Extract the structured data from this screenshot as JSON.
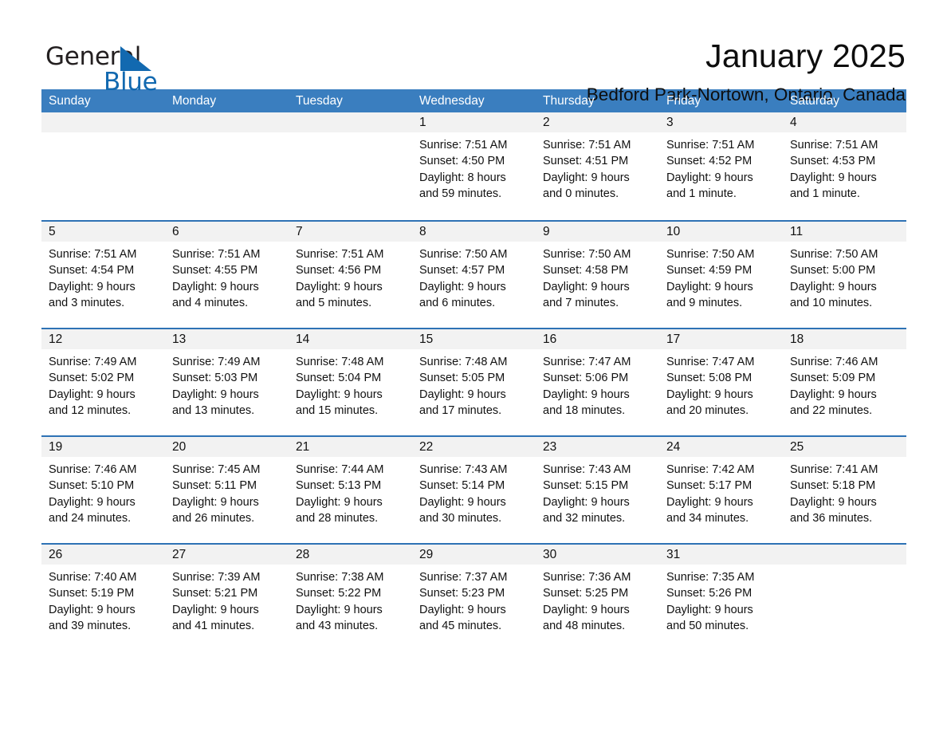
{
  "brand": {
    "word_general": "General",
    "word_blue": "Blue",
    "logo_icon": "triangle-logo-icon",
    "accent_color": "#1269b0"
  },
  "header": {
    "month_title": "January 2025",
    "location": "Bedford Park-Nortown, Ontario, Canada"
  },
  "calendar": {
    "header_bg": "#3a7ebf",
    "row_divider": "#2e72b5",
    "daynum_bg": "#f2f2f2",
    "weekdays": [
      "Sunday",
      "Monday",
      "Tuesday",
      "Wednesday",
      "Thursday",
      "Friday",
      "Saturday"
    ],
    "weeks": [
      [
        {
          "day": "",
          "sunrise": "",
          "sunset": "",
          "daylight1": "",
          "daylight2": ""
        },
        {
          "day": "",
          "sunrise": "",
          "sunset": "",
          "daylight1": "",
          "daylight2": ""
        },
        {
          "day": "",
          "sunrise": "",
          "sunset": "",
          "daylight1": "",
          "daylight2": ""
        },
        {
          "day": "1",
          "sunrise": "Sunrise: 7:51 AM",
          "sunset": "Sunset: 4:50 PM",
          "daylight1": "Daylight: 8 hours",
          "daylight2": "and 59 minutes."
        },
        {
          "day": "2",
          "sunrise": "Sunrise: 7:51 AM",
          "sunset": "Sunset: 4:51 PM",
          "daylight1": "Daylight: 9 hours",
          "daylight2": "and 0 minutes."
        },
        {
          "day": "3",
          "sunrise": "Sunrise: 7:51 AM",
          "sunset": "Sunset: 4:52 PM",
          "daylight1": "Daylight: 9 hours",
          "daylight2": "and 1 minute."
        },
        {
          "day": "4",
          "sunrise": "Sunrise: 7:51 AM",
          "sunset": "Sunset: 4:53 PM",
          "daylight1": "Daylight: 9 hours",
          "daylight2": "and 1 minute."
        }
      ],
      [
        {
          "day": "5",
          "sunrise": "Sunrise: 7:51 AM",
          "sunset": "Sunset: 4:54 PM",
          "daylight1": "Daylight: 9 hours",
          "daylight2": "and 3 minutes."
        },
        {
          "day": "6",
          "sunrise": "Sunrise: 7:51 AM",
          "sunset": "Sunset: 4:55 PM",
          "daylight1": "Daylight: 9 hours",
          "daylight2": "and 4 minutes."
        },
        {
          "day": "7",
          "sunrise": "Sunrise: 7:51 AM",
          "sunset": "Sunset: 4:56 PM",
          "daylight1": "Daylight: 9 hours",
          "daylight2": "and 5 minutes."
        },
        {
          "day": "8",
          "sunrise": "Sunrise: 7:50 AM",
          "sunset": "Sunset: 4:57 PM",
          "daylight1": "Daylight: 9 hours",
          "daylight2": "and 6 minutes."
        },
        {
          "day": "9",
          "sunrise": "Sunrise: 7:50 AM",
          "sunset": "Sunset: 4:58 PM",
          "daylight1": "Daylight: 9 hours",
          "daylight2": "and 7 minutes."
        },
        {
          "day": "10",
          "sunrise": "Sunrise: 7:50 AM",
          "sunset": "Sunset: 4:59 PM",
          "daylight1": "Daylight: 9 hours",
          "daylight2": "and 9 minutes."
        },
        {
          "day": "11",
          "sunrise": "Sunrise: 7:50 AM",
          "sunset": "Sunset: 5:00 PM",
          "daylight1": "Daylight: 9 hours",
          "daylight2": "and 10 minutes."
        }
      ],
      [
        {
          "day": "12",
          "sunrise": "Sunrise: 7:49 AM",
          "sunset": "Sunset: 5:02 PM",
          "daylight1": "Daylight: 9 hours",
          "daylight2": "and 12 minutes."
        },
        {
          "day": "13",
          "sunrise": "Sunrise: 7:49 AM",
          "sunset": "Sunset: 5:03 PM",
          "daylight1": "Daylight: 9 hours",
          "daylight2": "and 13 minutes."
        },
        {
          "day": "14",
          "sunrise": "Sunrise: 7:48 AM",
          "sunset": "Sunset: 5:04 PM",
          "daylight1": "Daylight: 9 hours",
          "daylight2": "and 15 minutes."
        },
        {
          "day": "15",
          "sunrise": "Sunrise: 7:48 AM",
          "sunset": "Sunset: 5:05 PM",
          "daylight1": "Daylight: 9 hours",
          "daylight2": "and 17 minutes."
        },
        {
          "day": "16",
          "sunrise": "Sunrise: 7:47 AM",
          "sunset": "Sunset: 5:06 PM",
          "daylight1": "Daylight: 9 hours",
          "daylight2": "and 18 minutes."
        },
        {
          "day": "17",
          "sunrise": "Sunrise: 7:47 AM",
          "sunset": "Sunset: 5:08 PM",
          "daylight1": "Daylight: 9 hours",
          "daylight2": "and 20 minutes."
        },
        {
          "day": "18",
          "sunrise": "Sunrise: 7:46 AM",
          "sunset": "Sunset: 5:09 PM",
          "daylight1": "Daylight: 9 hours",
          "daylight2": "and 22 minutes."
        }
      ],
      [
        {
          "day": "19",
          "sunrise": "Sunrise: 7:46 AM",
          "sunset": "Sunset: 5:10 PM",
          "daylight1": "Daylight: 9 hours",
          "daylight2": "and 24 minutes."
        },
        {
          "day": "20",
          "sunrise": "Sunrise: 7:45 AM",
          "sunset": "Sunset: 5:11 PM",
          "daylight1": "Daylight: 9 hours",
          "daylight2": "and 26 minutes."
        },
        {
          "day": "21",
          "sunrise": "Sunrise: 7:44 AM",
          "sunset": "Sunset: 5:13 PM",
          "daylight1": "Daylight: 9 hours",
          "daylight2": "and 28 minutes."
        },
        {
          "day": "22",
          "sunrise": "Sunrise: 7:43 AM",
          "sunset": "Sunset: 5:14 PM",
          "daylight1": "Daylight: 9 hours",
          "daylight2": "and 30 minutes."
        },
        {
          "day": "23",
          "sunrise": "Sunrise: 7:43 AM",
          "sunset": "Sunset: 5:15 PM",
          "daylight1": "Daylight: 9 hours",
          "daylight2": "and 32 minutes."
        },
        {
          "day": "24",
          "sunrise": "Sunrise: 7:42 AM",
          "sunset": "Sunset: 5:17 PM",
          "daylight1": "Daylight: 9 hours",
          "daylight2": "and 34 minutes."
        },
        {
          "day": "25",
          "sunrise": "Sunrise: 7:41 AM",
          "sunset": "Sunset: 5:18 PM",
          "daylight1": "Daylight: 9 hours",
          "daylight2": "and 36 minutes."
        }
      ],
      [
        {
          "day": "26",
          "sunrise": "Sunrise: 7:40 AM",
          "sunset": "Sunset: 5:19 PM",
          "daylight1": "Daylight: 9 hours",
          "daylight2": "and 39 minutes."
        },
        {
          "day": "27",
          "sunrise": "Sunrise: 7:39 AM",
          "sunset": "Sunset: 5:21 PM",
          "daylight1": "Daylight: 9 hours",
          "daylight2": "and 41 minutes."
        },
        {
          "day": "28",
          "sunrise": "Sunrise: 7:38 AM",
          "sunset": "Sunset: 5:22 PM",
          "daylight1": "Daylight: 9 hours",
          "daylight2": "and 43 minutes."
        },
        {
          "day": "29",
          "sunrise": "Sunrise: 7:37 AM",
          "sunset": "Sunset: 5:23 PM",
          "daylight1": "Daylight: 9 hours",
          "daylight2": "and 45 minutes."
        },
        {
          "day": "30",
          "sunrise": "Sunrise: 7:36 AM",
          "sunset": "Sunset: 5:25 PM",
          "daylight1": "Daylight: 9 hours",
          "daylight2": "and 48 minutes."
        },
        {
          "day": "31",
          "sunrise": "Sunrise: 7:35 AM",
          "sunset": "Sunset: 5:26 PM",
          "daylight1": "Daylight: 9 hours",
          "daylight2": "and 50 minutes."
        },
        {
          "day": "",
          "sunrise": "",
          "sunset": "",
          "daylight1": "",
          "daylight2": ""
        }
      ]
    ]
  }
}
